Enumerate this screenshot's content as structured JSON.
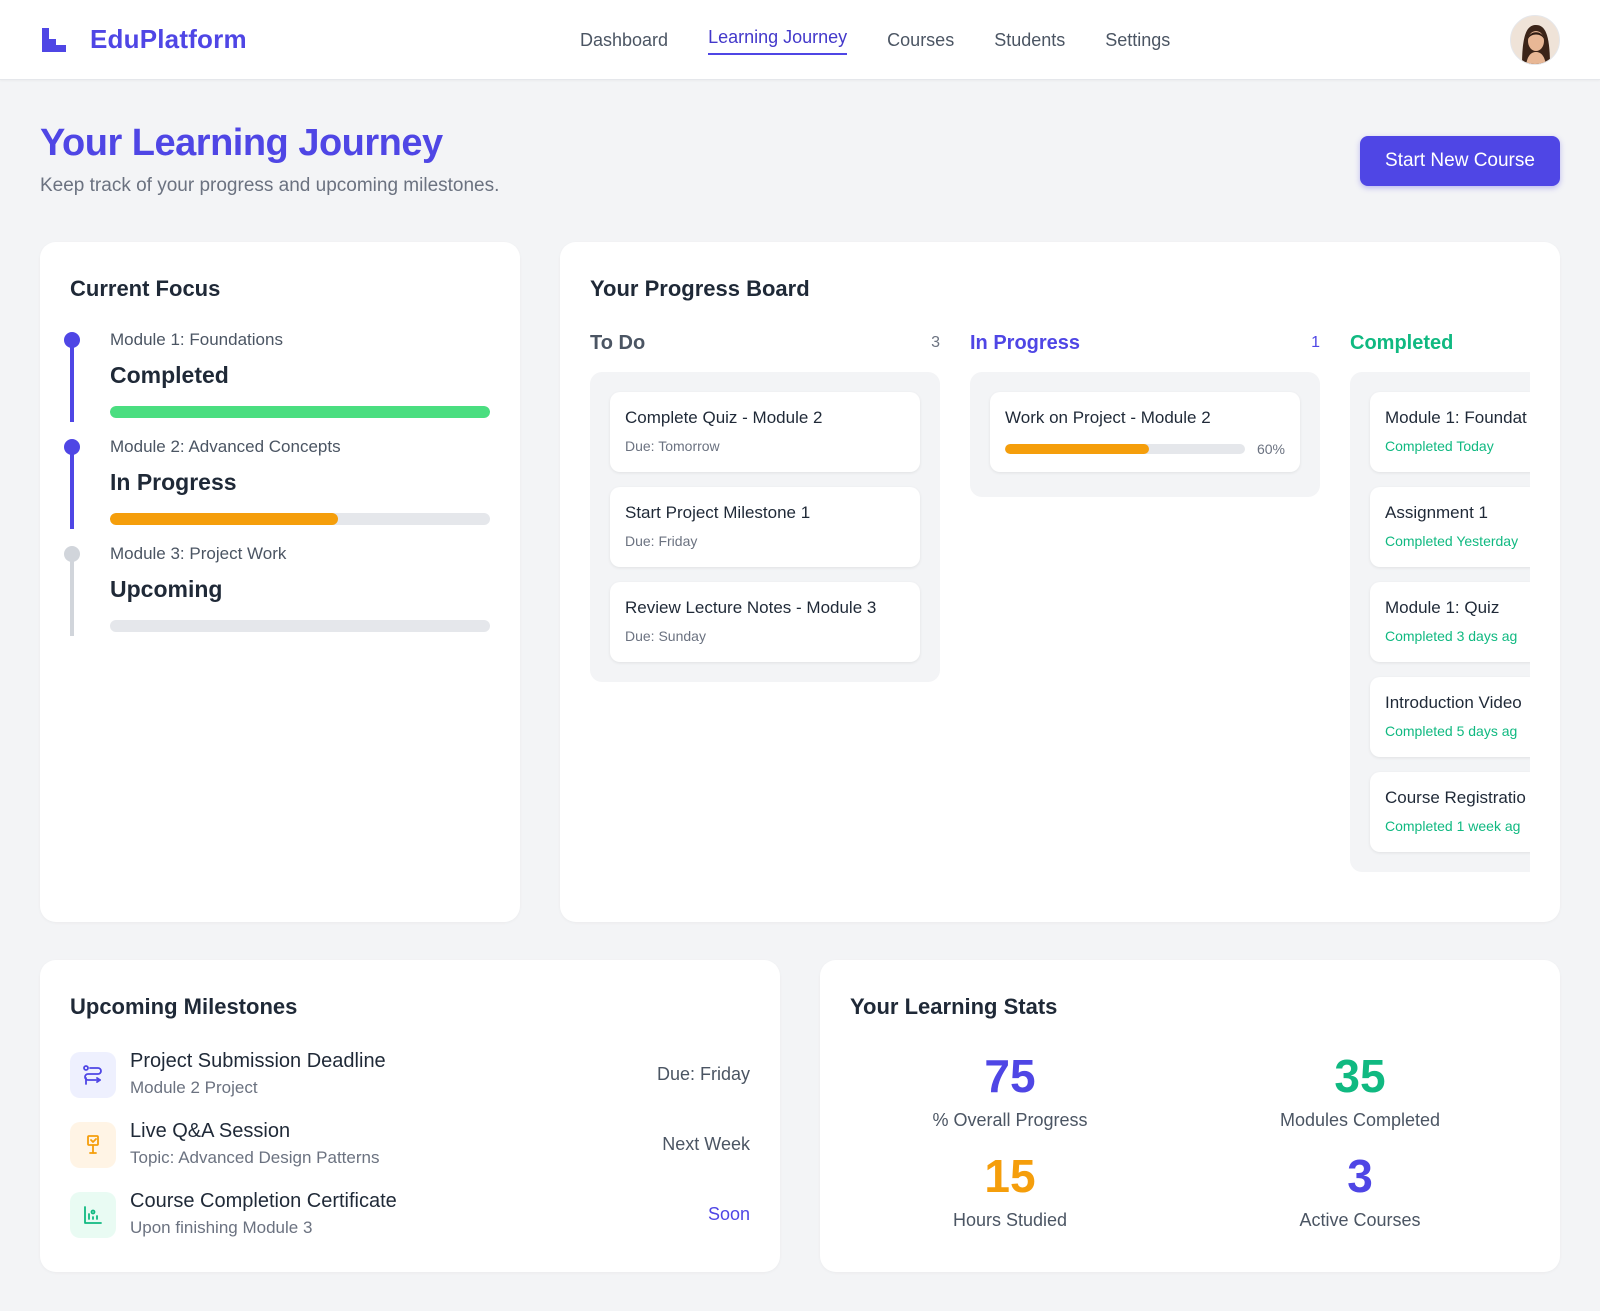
{
  "brand": {
    "name": "EduPlatform",
    "color": "#4f46e5"
  },
  "nav": {
    "items": [
      "Dashboard",
      "Learning Journey",
      "Courses",
      "Students",
      "Settings"
    ],
    "active": "Learning Journey"
  },
  "header": {
    "title": "Your Learning Journey",
    "subtitle": "Keep track of your progress and upcoming milestones.",
    "cta_label": "Start New Course"
  },
  "current_focus": {
    "title": "Current Focus",
    "modules": [
      {
        "module": "Module 1: Foundations",
        "status": "Completed",
        "progress": 1.0,
        "color": "#4ade80"
      },
      {
        "module": "Module 2: Advanced Concepts",
        "status": "In Progress",
        "progress": 0.6,
        "color": "#f59e0b"
      },
      {
        "module": "Module 3: Project Work",
        "status": "Upcoming",
        "progress": 0.0,
        "color": "#e5e7eb"
      }
    ]
  },
  "progress_board": {
    "title": "Your Progress Board",
    "columns": [
      {
        "title": "To Do",
        "count": "3",
        "color": "#4b5563",
        "tasks": [
          {
            "title": "Complete Quiz - Module 2",
            "sub": "Due: Tomorrow"
          },
          {
            "title": "Start Project Milestone 1",
            "sub": "Due: Friday"
          },
          {
            "title": "Review Lecture Notes - Module 3",
            "sub": "Due: Sunday"
          }
        ]
      },
      {
        "title": "In Progress",
        "count": "1",
        "color": "#4f46e5",
        "tasks": [
          {
            "title": "Work on Project - Module 2",
            "progress": 0.6,
            "progress_label": "60%"
          }
        ]
      },
      {
        "title": "Completed",
        "count": "",
        "color": "#10b981",
        "tasks": [
          {
            "title": "Module 1: Foundat",
            "sub": "Completed Today"
          },
          {
            "title": "Assignment 1",
            "sub": "Completed Yesterday"
          },
          {
            "title": "Module 1: Quiz",
            "sub": "Completed 3 days ag"
          },
          {
            "title": "Introduction Video",
            "sub": "Completed 5 days ag"
          },
          {
            "title": "Course Registratio",
            "sub": "Completed 1 week ag"
          }
        ]
      }
    ]
  },
  "milestones": {
    "title": "Upcoming Milestones",
    "items": [
      {
        "title": "Project Submission Deadline",
        "sub": "Module 2 Project",
        "due": "Due: Friday",
        "icon": "route-icon",
        "accent": "#4f46e5",
        "due_color": "#4b5563"
      },
      {
        "title": "Live Q&A Session",
        "sub": "Topic: Advanced Design Patterns",
        "due": "Next Week",
        "icon": "presentation-icon",
        "accent": "#f59e0b",
        "due_color": "#4b5563"
      },
      {
        "title": "Course Completion Certificate",
        "sub": "Upon finishing Module 3",
        "due": "Soon",
        "icon": "chart-icon",
        "accent": "#10b981",
        "due_color": "#4f46e5"
      }
    ]
  },
  "stats": {
    "title": "Your Learning Stats",
    "items": [
      {
        "value": "75",
        "label": "% Overall Progress",
        "color": "#4f46e5"
      },
      {
        "value": "35",
        "label": "Modules Completed",
        "color": "#10b981"
      },
      {
        "value": "15",
        "label": "Hours Studied",
        "color": "#f59e0b"
      },
      {
        "value": "3",
        "label": "Active Courses",
        "color": "#4f46e5"
      }
    ]
  }
}
